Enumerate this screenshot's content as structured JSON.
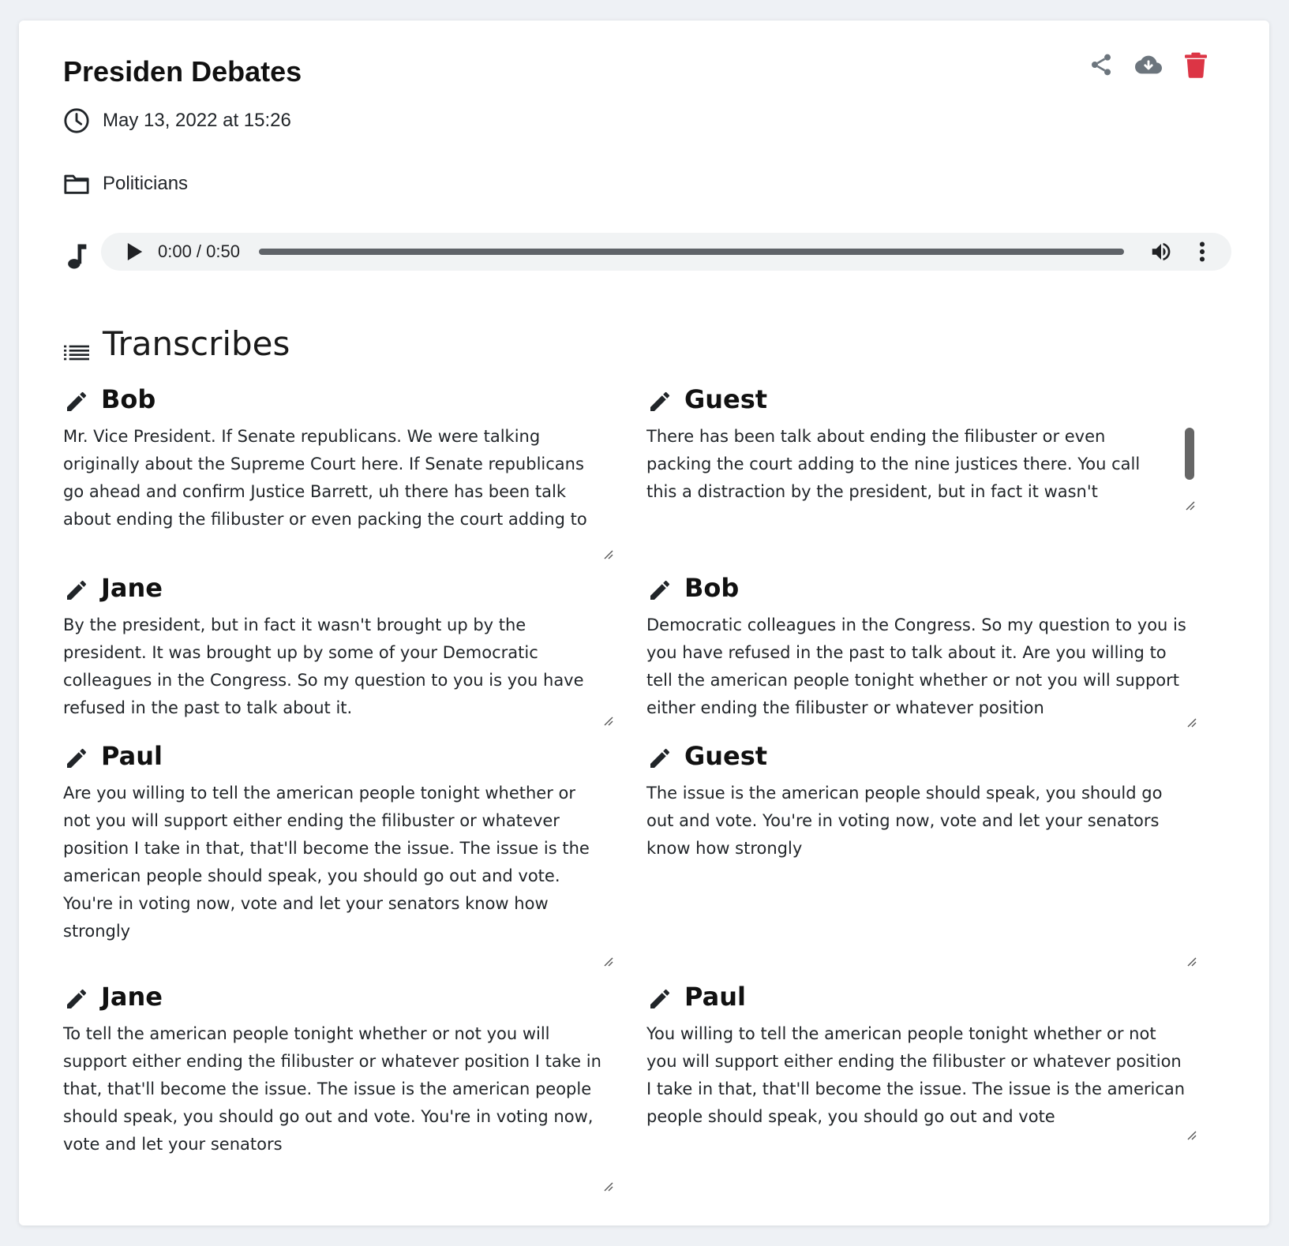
{
  "header": {
    "title": "Presiden Debates",
    "date": "May 13, 2022 at 15:26",
    "folder": "Politicians",
    "actions": {
      "share_icon": "share-icon",
      "download_icon": "cloud-download-icon",
      "delete_icon": "trash-icon",
      "delete_color": "#dc3545"
    }
  },
  "audio": {
    "time": "0:00 / 0:50",
    "progress_fraction": 0
  },
  "section": {
    "title": "Transcribes"
  },
  "entries": [
    {
      "speaker": "Bob",
      "text": "Mr. Vice President. If Senate republicans. We were talking originally about the Supreme Court here. If Senate republicans go ahead and confirm Justice Barrett, uh there has been talk about ending the filibuster or even packing the court adding to"
    },
    {
      "speaker": "Guest",
      "text": "There has been talk about ending the filibuster or even packing the court adding to the nine justices there. You call this a distraction by the president, but in fact it wasn't brought up by"
    },
    {
      "speaker": "Jane",
      "text": "By the president, but in fact it wasn't brought up by the president. It was brought up by some of your Democratic colleagues in the Congress. So my question to you is you have refused in the past to talk about it."
    },
    {
      "speaker": "Bob",
      "text": "Democratic colleagues in the Congress. So my question to you is you have refused in the past to talk about it. Are you willing to tell the american people tonight whether or not you will support either ending the filibuster or whatever position"
    },
    {
      "speaker": "Paul",
      "text": "Are you willing to tell the american people tonight whether or not you will support either ending the filibuster or whatever position I take in that, that'll become the issue. The issue is the american people should speak, you should go out and vote. You're in voting now, vote and let your senators know how strongly"
    },
    {
      "speaker": "Guest",
      "text": "The issue is the american people should speak, you should go out and vote. You're in voting now, vote and let your senators know how strongly"
    },
    {
      "speaker": "Jane",
      "text": "To tell the american people tonight whether or not you will support either ending the filibuster or whatever position I take in that, that'll become the issue. The issue is the american people should speak, you should go out and vote. You're in voting now, vote and let your senators"
    },
    {
      "speaker": "Paul",
      "text": "You willing to tell the american people tonight whether or not you will support either ending the filibuster or whatever position I take in that, that'll become the issue. The issue is the american people should speak, you should go out and vote"
    }
  ]
}
